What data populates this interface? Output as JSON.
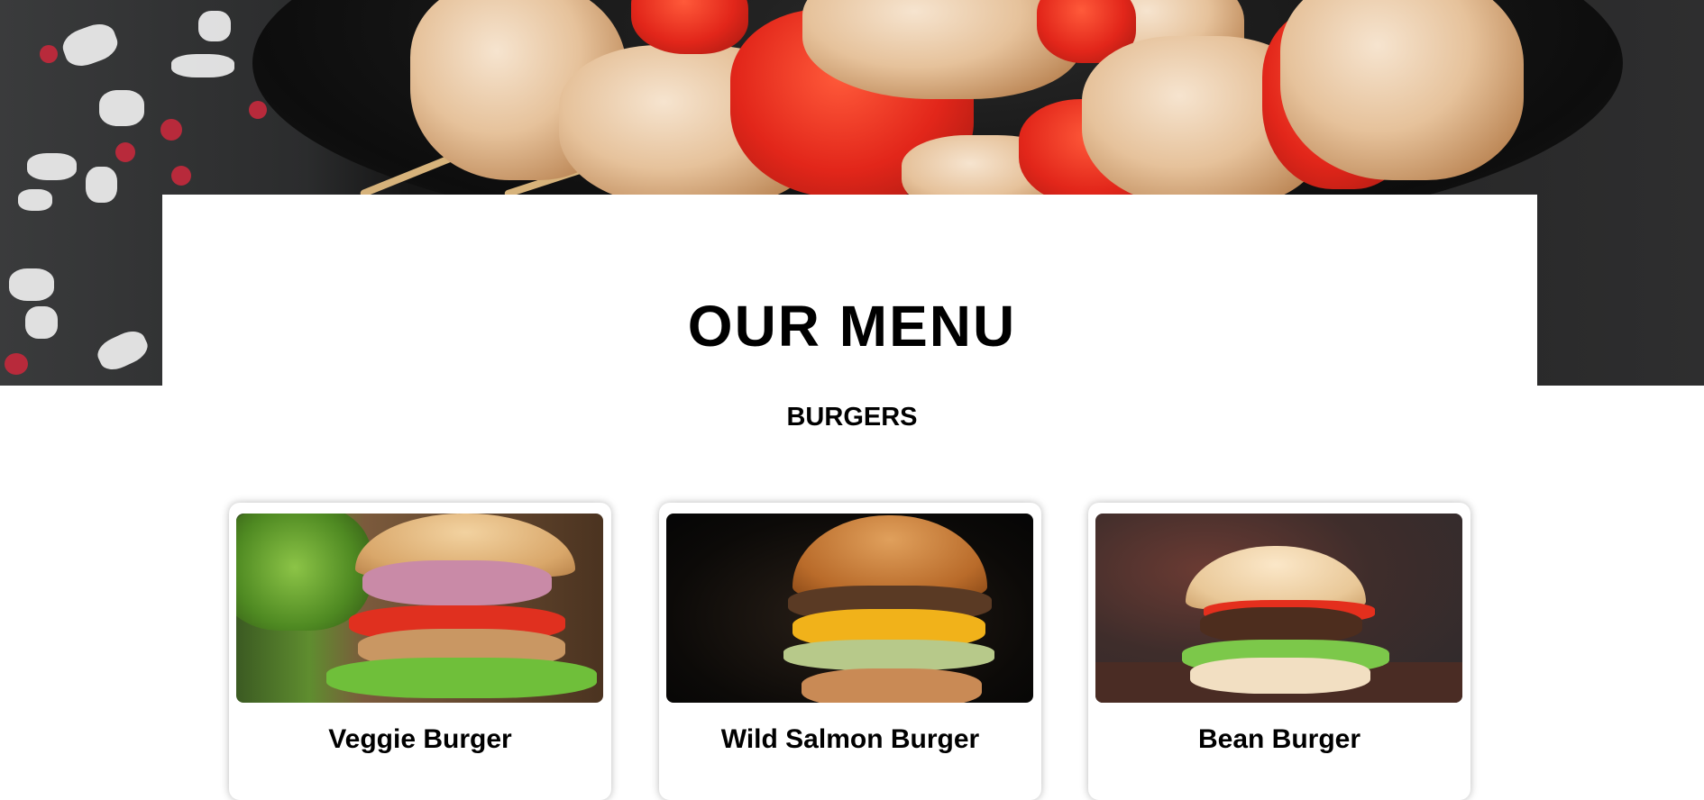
{
  "hero": {
    "title": "OUR MENU"
  },
  "section": {
    "heading": "BURGERS"
  },
  "menu_items": [
    {
      "name": "Veggie Burger"
    },
    {
      "name": "Wild Salmon Burger"
    },
    {
      "name": "Bean Burger"
    }
  ],
  "colors": {
    "background": "#ffffff",
    "text": "#000000",
    "hero_dark": "#1b1b1b"
  }
}
